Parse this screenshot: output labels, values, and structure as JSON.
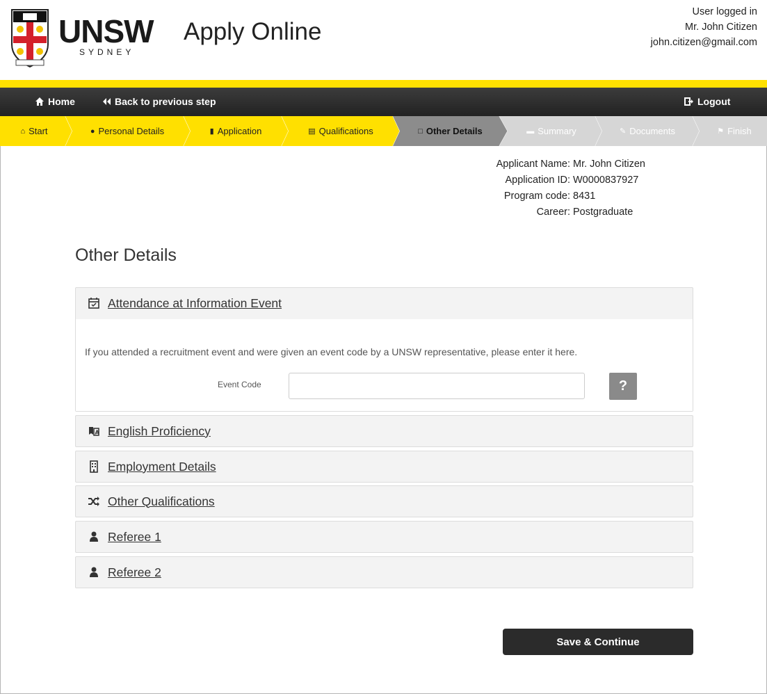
{
  "header": {
    "logo": "UNSW",
    "logo_sub": "SYDNEY",
    "app_title": "Apply Online",
    "user_label": "User logged in",
    "user_name": "Mr. John Citizen",
    "user_email": "john.citizen@gmail.com"
  },
  "topnav": {
    "home": "Home",
    "back": "Back to previous step",
    "logout": "Logout"
  },
  "steps": [
    {
      "label": "Start",
      "icon": "home-icon",
      "state": "done"
    },
    {
      "label": "Personal Details",
      "icon": "user-icon",
      "state": "done"
    },
    {
      "label": "Application",
      "icon": "book-icon",
      "state": "done"
    },
    {
      "label": "Qualifications",
      "icon": "institution-icon",
      "state": "done"
    },
    {
      "label": "Other Details",
      "icon": "file-icon",
      "state": "current"
    },
    {
      "label": "Summary",
      "icon": "list-icon",
      "state": "pending"
    },
    {
      "label": "Documents",
      "icon": "paperclip-icon",
      "state": "pending"
    },
    {
      "label": "Finish",
      "icon": "flag-icon",
      "state": "pending"
    }
  ],
  "applicant": {
    "name_label": "Applicant Name:",
    "name": "Mr. John Citizen",
    "id_label": "Application ID:",
    "id": "W0000837927",
    "program_label": "Program code:",
    "program": "8431",
    "career_label": "Career:",
    "career": "Postgraduate"
  },
  "page_title": "Other Details",
  "sections": [
    {
      "title": "Attendance at Information Event",
      "icon": "calendar-check-icon",
      "expanded": true
    },
    {
      "title": "English Proficiency",
      "icon": "language-icon",
      "expanded": false
    },
    {
      "title": "Employment Details",
      "icon": "building-icon",
      "expanded": false
    },
    {
      "title": "Other Qualifications",
      "icon": "shuffle-icon",
      "expanded": false
    },
    {
      "title": "Referee 1",
      "icon": "user-icon",
      "expanded": false
    },
    {
      "title": "Referee 2",
      "icon": "user-icon",
      "expanded": false
    }
  ],
  "event": {
    "description": "If you attended a recruitment event and were given an event code by a UNSW representative, please enter it here.",
    "field_label": "Event Code",
    "field_value": "",
    "help": "?"
  },
  "save_button": "Save & Continue",
  "colors": {
    "accent_yellow": "#ffe000",
    "nav_dark": "#2b2b2b",
    "current_step": "#8c8c8c",
    "pending_step": "#d6d6d6"
  }
}
